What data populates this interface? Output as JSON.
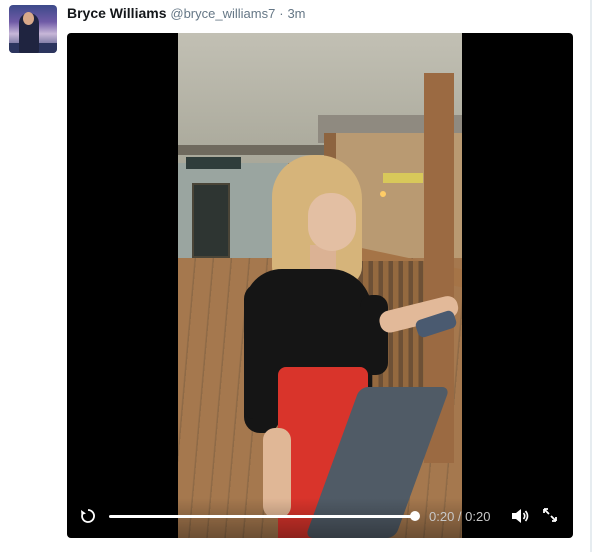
{
  "tweet": {
    "author": {
      "name": "Bryce Williams",
      "handle": "@bryce_williams7",
      "separator": "·",
      "time": "3m"
    },
    "video": {
      "progress": 1.0,
      "time_label": "0:20 / 0:20",
      "controls": {
        "replay_icon": "replay-icon",
        "volume_icon": "volume-icon",
        "fullscreen_icon": "fullscreen-icon"
      },
      "colors": {
        "player_background": "#000000",
        "progress": "#ffffff"
      }
    }
  }
}
